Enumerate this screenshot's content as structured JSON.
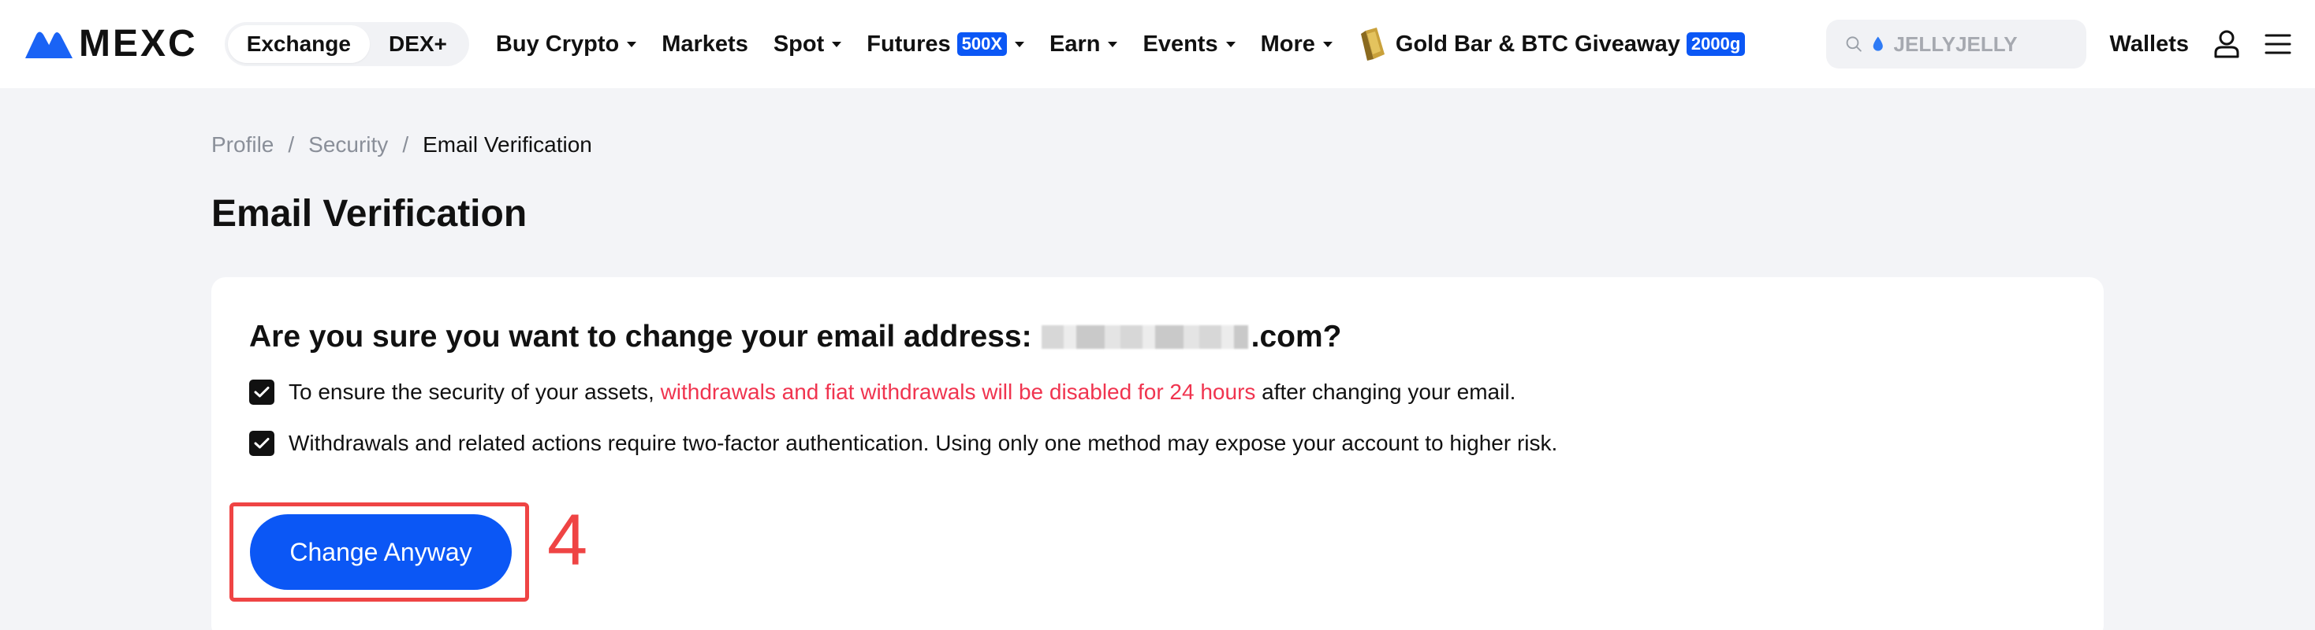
{
  "header": {
    "logo_text": "MEXC",
    "segment": [
      {
        "label": "Exchange",
        "active": true
      },
      {
        "label": "DEX+",
        "active": false
      }
    ],
    "nav": [
      {
        "label": "Buy Crypto",
        "dropdown": true
      },
      {
        "label": "Markets",
        "dropdown": false
      },
      {
        "label": "Spot",
        "dropdown": true
      },
      {
        "label": "Futures",
        "badge": "500X",
        "dropdown": true
      },
      {
        "label": "Earn",
        "dropdown": true
      },
      {
        "label": "Events",
        "dropdown": true
      },
      {
        "label": "More",
        "dropdown": true
      }
    ],
    "promo": {
      "label": "Gold Bar & BTC Giveaway",
      "badge": "2000g"
    },
    "search": {
      "placeholder": "JELLYJELLY"
    },
    "wallets_label": "Wallets",
    "icons": {
      "user": "user-icon",
      "menu": "menu-icon",
      "search": "search-icon"
    }
  },
  "breadcrumb": {
    "items": [
      "Profile",
      "Security",
      "Email Verification"
    ],
    "separator": "/"
  },
  "page": {
    "title": "Email Verification"
  },
  "card": {
    "question_prefix": "Are you sure you want to change your email address: ",
    "question_suffix": ".com?",
    "checks": [
      {
        "checked": true,
        "text_before": "To ensure the security of your assets, ",
        "text_warning": "withdrawals and fiat withdrawals will be disabled for 24 hours",
        "text_after": " after changing your email."
      },
      {
        "checked": true,
        "text_before": "Withdrawals and related actions require two-factor authentication. Using only one method may expose your account to higher risk.",
        "text_warning": "",
        "text_after": ""
      }
    ],
    "primary_button": "Change Anyway"
  },
  "annotation": {
    "step_number": "4"
  },
  "colors": {
    "brand_blue": "#0b57f5",
    "warning_red": "#f0344f",
    "annotation_red": "#ef4444",
    "page_bg": "#f3f4f7"
  }
}
